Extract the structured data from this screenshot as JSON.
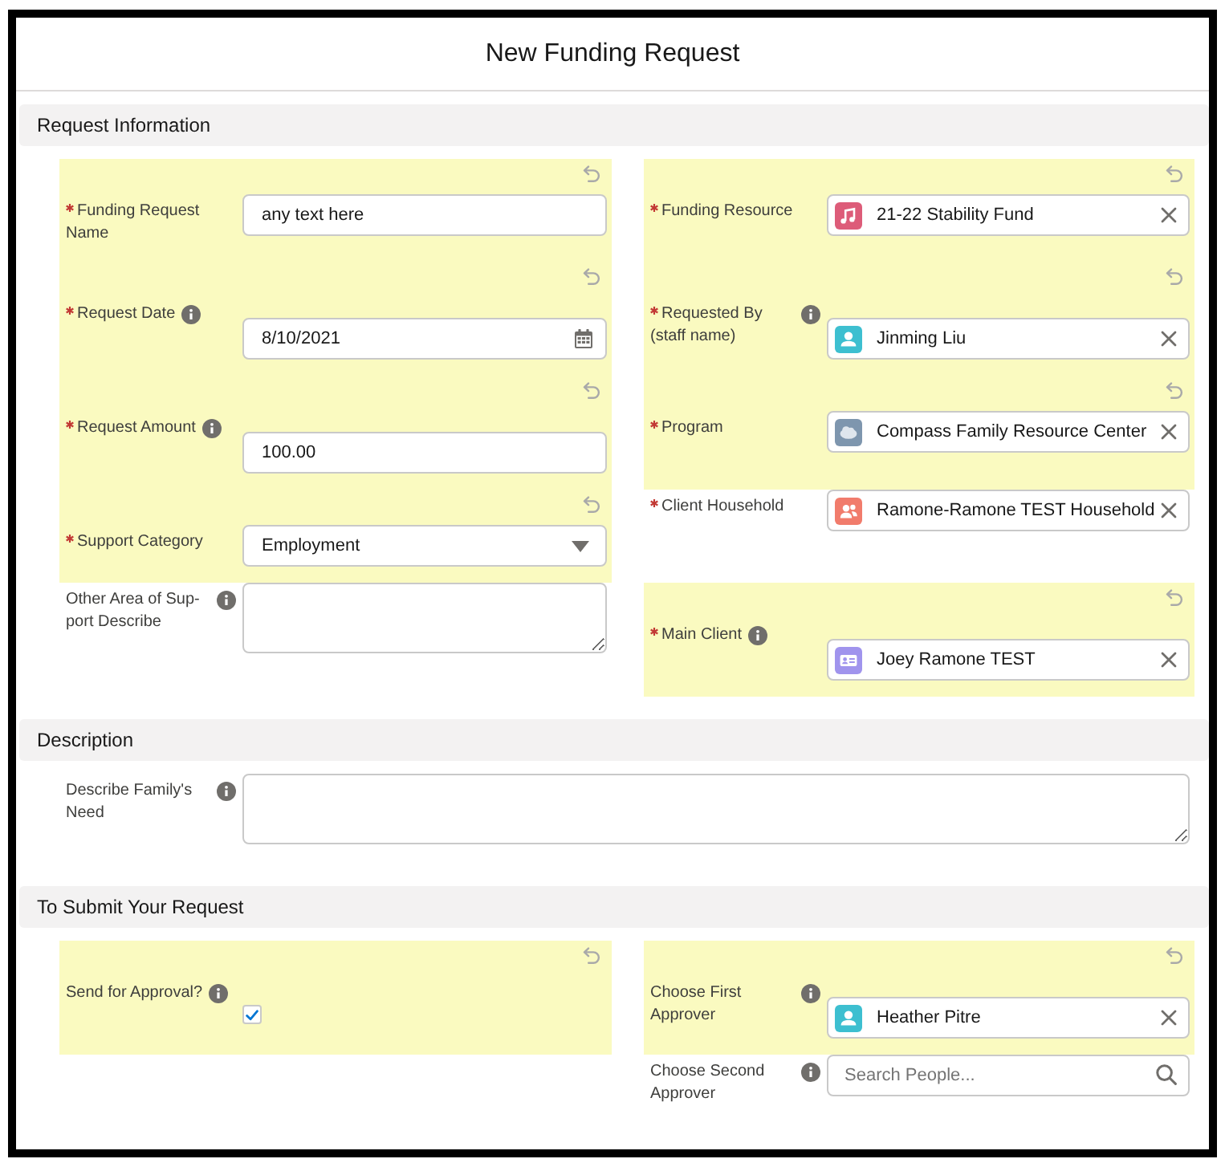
{
  "dialog": {
    "title": "New Funding Request"
  },
  "sections": [
    {
      "title": "Request Information",
      "rows": [
        {
          "left": {
            "label": "Funding Request Name",
            "required": true,
            "help": false,
            "edited": true,
            "kind": "text",
            "value": "any text here"
          },
          "right": {
            "label": "Funding Resource",
            "required": true,
            "help": false,
            "edited": true,
            "kind": "lookup",
            "record": {
              "name": "21-22 Stability Fund",
              "kind": "fund",
              "color": "#dd5c79"
            }
          }
        },
        {
          "left": {
            "label": "Request Date",
            "required": true,
            "help": true,
            "edited": true,
            "kind": "date",
            "value": "8/10/2021"
          },
          "right": {
            "label": "Requested By (staff name)",
            "required": true,
            "help": true,
            "edited": true,
            "kind": "lookup",
            "record": {
              "name": "Jinming Liu",
              "kind": "user",
              "color": "#3dbfd0"
            }
          }
        },
        {
          "left": {
            "label": "Request Amount",
            "required": true,
            "help": true,
            "edited": true,
            "kind": "text",
            "value": "100.00"
          },
          "right": {
            "label": "Program",
            "required": true,
            "help": false,
            "edited": true,
            "kind": "lookup",
            "record": {
              "name": "Compass Family Resource Center",
              "kind": "program",
              "color": "#7e96ae"
            }
          }
        },
        {
          "left": {
            "label": "Support Category",
            "required": true,
            "help": false,
            "edited": true,
            "kind": "select",
            "value": "Employment"
          },
          "right": {
            "label": "Client Household",
            "required": true,
            "help": false,
            "edited": false,
            "kind": "lookup",
            "record": {
              "name": "Ramone-Ramone TEST Household",
              "kind": "household",
              "color": "#f17c6c"
            }
          }
        },
        {
          "left": {
            "label": "Other Area of Sup-port Describe",
            "required": false,
            "help": true,
            "edited": false,
            "kind": "textarea"
          },
          "right": {
            "label": "Main Client",
            "required": true,
            "help": true,
            "edited": true,
            "kind": "lookup",
            "record": {
              "name": "Joey Ramone TEST",
              "kind": "contact",
              "color": "#a094ed"
            }
          }
        }
      ]
    },
    {
      "title": "Description",
      "rows": [
        {
          "wide": {
            "label": "Describe Family's Need",
            "required": false,
            "help": true,
            "edited": false,
            "kind": "textarea"
          }
        }
      ]
    },
    {
      "title": "To Submit Your Request",
      "rows": [
        {
          "left": {
            "label": "Send for Approval?",
            "required": false,
            "help": true,
            "edited": true,
            "kind": "checkbox",
            "checked": true
          },
          "right": {
            "label": "Choose First Approver",
            "required": false,
            "help": true,
            "edited": true,
            "kind": "lookup",
            "record": {
              "name": "Heather Pitre",
              "kind": "user",
              "color": "#3dbfd0"
            }
          }
        },
        {
          "right": {
            "label": "Choose Second Approver",
            "required": false,
            "help": true,
            "edited": false,
            "kind": "search",
            "placeholder": "Search People..."
          }
        }
      ]
    }
  ]
}
